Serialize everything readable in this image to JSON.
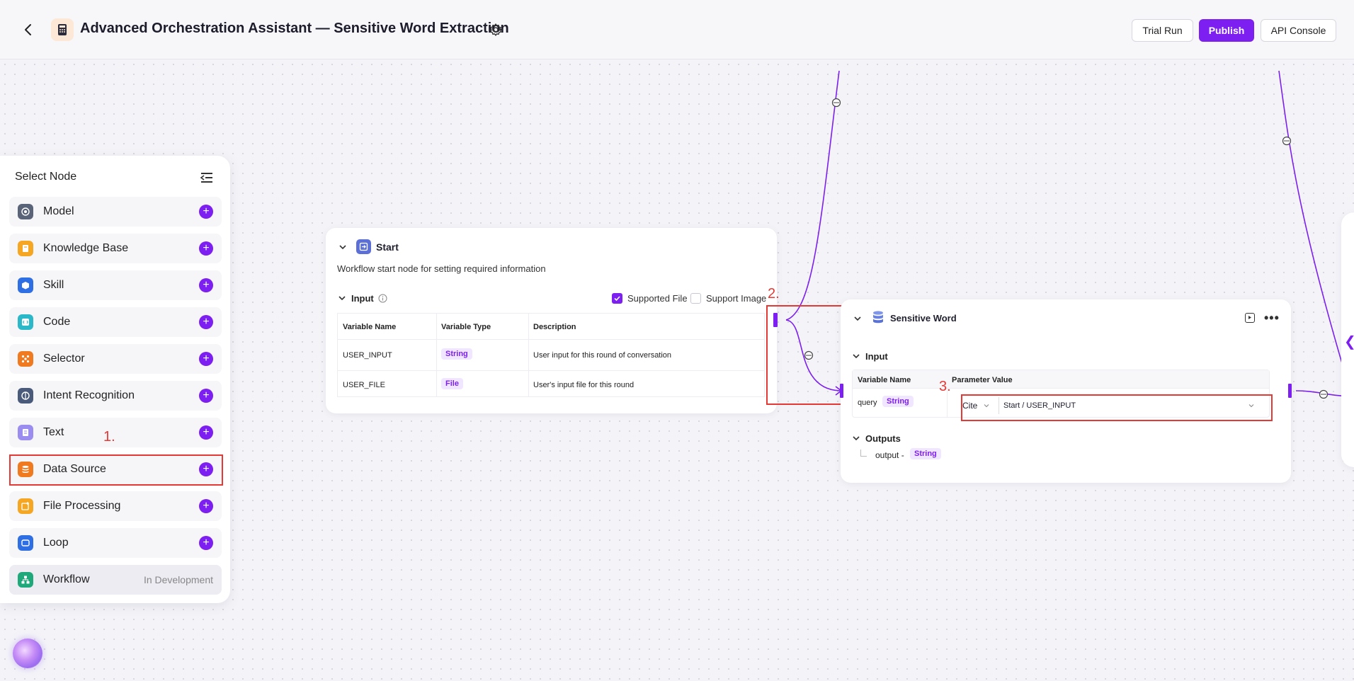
{
  "header": {
    "title": "Advanced Orchestration Assistant — Sensitive Word Extraction",
    "buttons": {
      "trial_run": "Trial Run",
      "publish": "Publish",
      "api_console": "API Console"
    }
  },
  "node_panel": {
    "title": "Select Node",
    "items": [
      {
        "label": "Model",
        "icon": "model-icon",
        "color": "#5a6478"
      },
      {
        "label": "Knowledge Base",
        "icon": "book-icon",
        "color": "#f5a623"
      },
      {
        "label": "Skill",
        "icon": "cube-icon",
        "color": "#2f6fe4"
      },
      {
        "label": "Code",
        "icon": "code-icon",
        "color": "#2bb8c9"
      },
      {
        "label": "Selector",
        "icon": "selector-icon",
        "color": "#f07a1f"
      },
      {
        "label": "Intent Recognition",
        "icon": "intent-icon",
        "color": "#4a5a7a"
      },
      {
        "label": "Text",
        "icon": "text-icon",
        "color": "#9b8cf0"
      },
      {
        "label": "Data Source",
        "icon": "database-icon",
        "color": "#f07a1f"
      },
      {
        "label": "File Processing",
        "icon": "file-process-icon",
        "color": "#f5a623"
      },
      {
        "label": "Loop",
        "icon": "loop-icon",
        "color": "#2f6fe4"
      },
      {
        "label": "Workflow",
        "icon": "workflow-icon",
        "color": "#1fa87a",
        "status": "In Development"
      }
    ]
  },
  "annotations": [
    "1.",
    "2.",
    "3."
  ],
  "start_node": {
    "title": "Start",
    "description": "Workflow start node for setting required information",
    "input_label": "Input",
    "supported_file": "Supported File",
    "support_image": "Support Image",
    "columns": [
      "Variable Name",
      "Variable Type",
      "Description"
    ],
    "rows": [
      {
        "name": "USER_INPUT",
        "type": "String",
        "description": "User input for this round of conversation"
      },
      {
        "name": "USER_FILE",
        "type": "File",
        "description": "User's input file for this round"
      }
    ]
  },
  "sensitive_node": {
    "title": "Sensitive Word",
    "input_label": "Input",
    "columns": [
      "Variable Name",
      "Parameter Value"
    ],
    "param": {
      "name": "query",
      "type": "String",
      "mode": "Cite",
      "value": "Start / USER_INPUT"
    },
    "outputs_label": "Outputs",
    "output": {
      "name": "output -",
      "type": "String"
    }
  },
  "colors": {
    "accent": "#7c1ff0",
    "annotation": "#e53935"
  }
}
